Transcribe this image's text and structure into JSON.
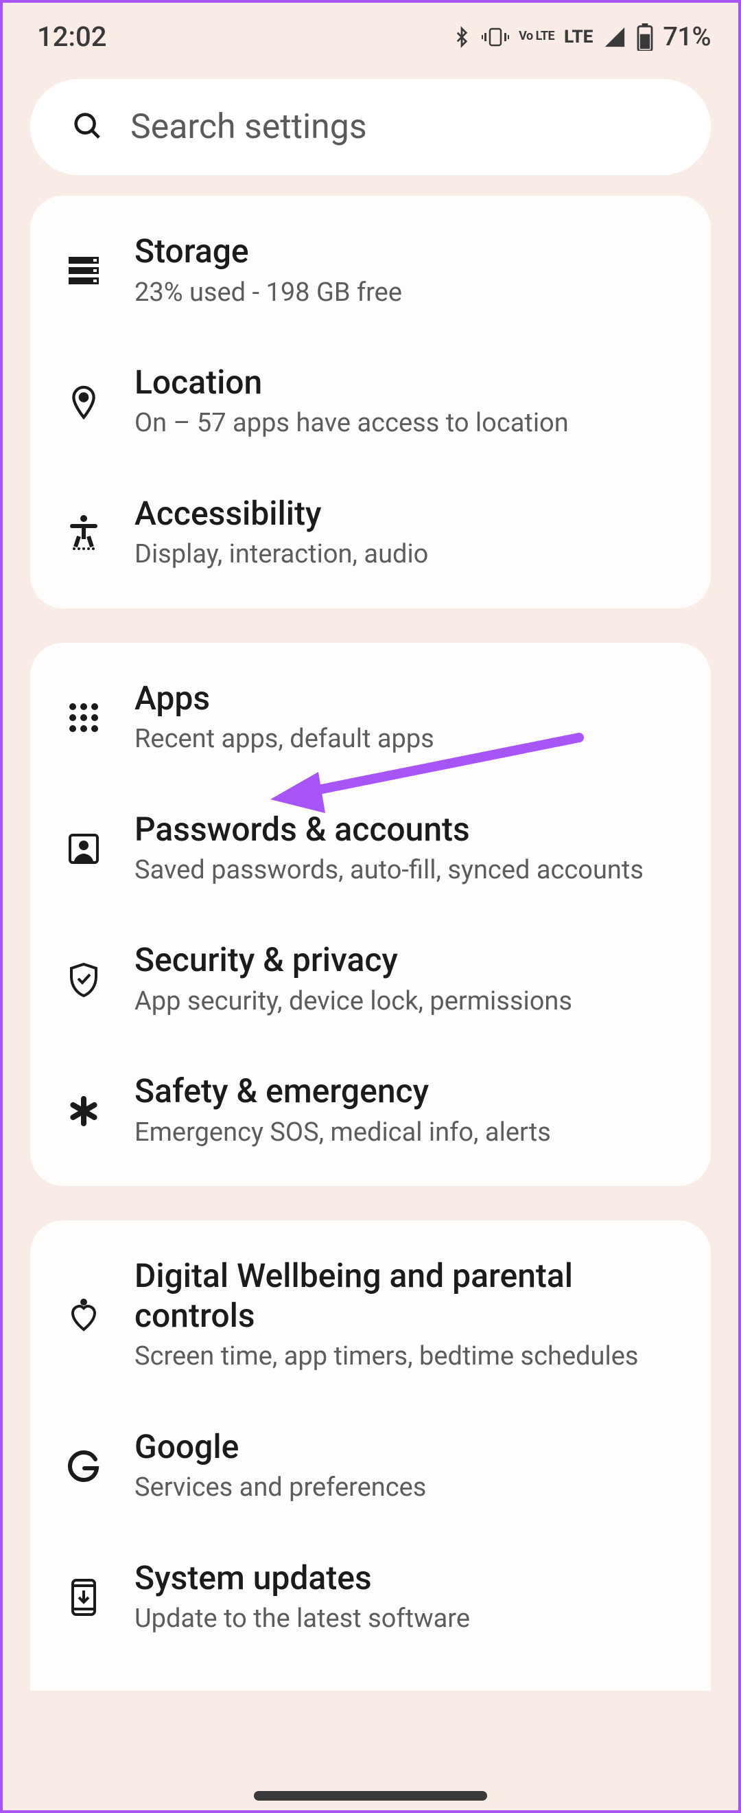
{
  "status": {
    "time": "12:02",
    "lte_label": "LTE",
    "volte_label": "Vo LTE",
    "battery": "71%"
  },
  "search": {
    "placeholder": "Search settings"
  },
  "groups": [
    {
      "items": [
        {
          "icon": "storage",
          "title": "Storage",
          "sub": "23% used - 198 GB free"
        },
        {
          "icon": "location",
          "title": "Location",
          "sub": "On – 57 apps have access to location"
        },
        {
          "icon": "accessibility",
          "title": "Accessibility",
          "sub": "Display, interaction, audio"
        }
      ]
    },
    {
      "items": [
        {
          "icon": "apps",
          "title": "Apps",
          "sub": "Recent apps, default apps"
        },
        {
          "icon": "passwords",
          "title": "Passwords & accounts",
          "sub": "Saved passwords, auto-fill, synced accounts"
        },
        {
          "icon": "security",
          "title": "Security & privacy",
          "sub": "App security, device lock, permissions"
        },
        {
          "icon": "safety",
          "title": "Safety & emergency",
          "sub": "Emergency SOS, medical info, alerts"
        }
      ]
    },
    {
      "items": [
        {
          "icon": "wellbeing",
          "title": "Digital Wellbeing and parental controls",
          "sub": "Screen time, app timers, bedtime schedules"
        },
        {
          "icon": "google",
          "title": "Google",
          "sub": "Services and preferences"
        },
        {
          "icon": "update",
          "title": "System updates",
          "sub": "Update to the latest software"
        }
      ]
    }
  ],
  "annotation": {
    "color": "#a855f7"
  }
}
